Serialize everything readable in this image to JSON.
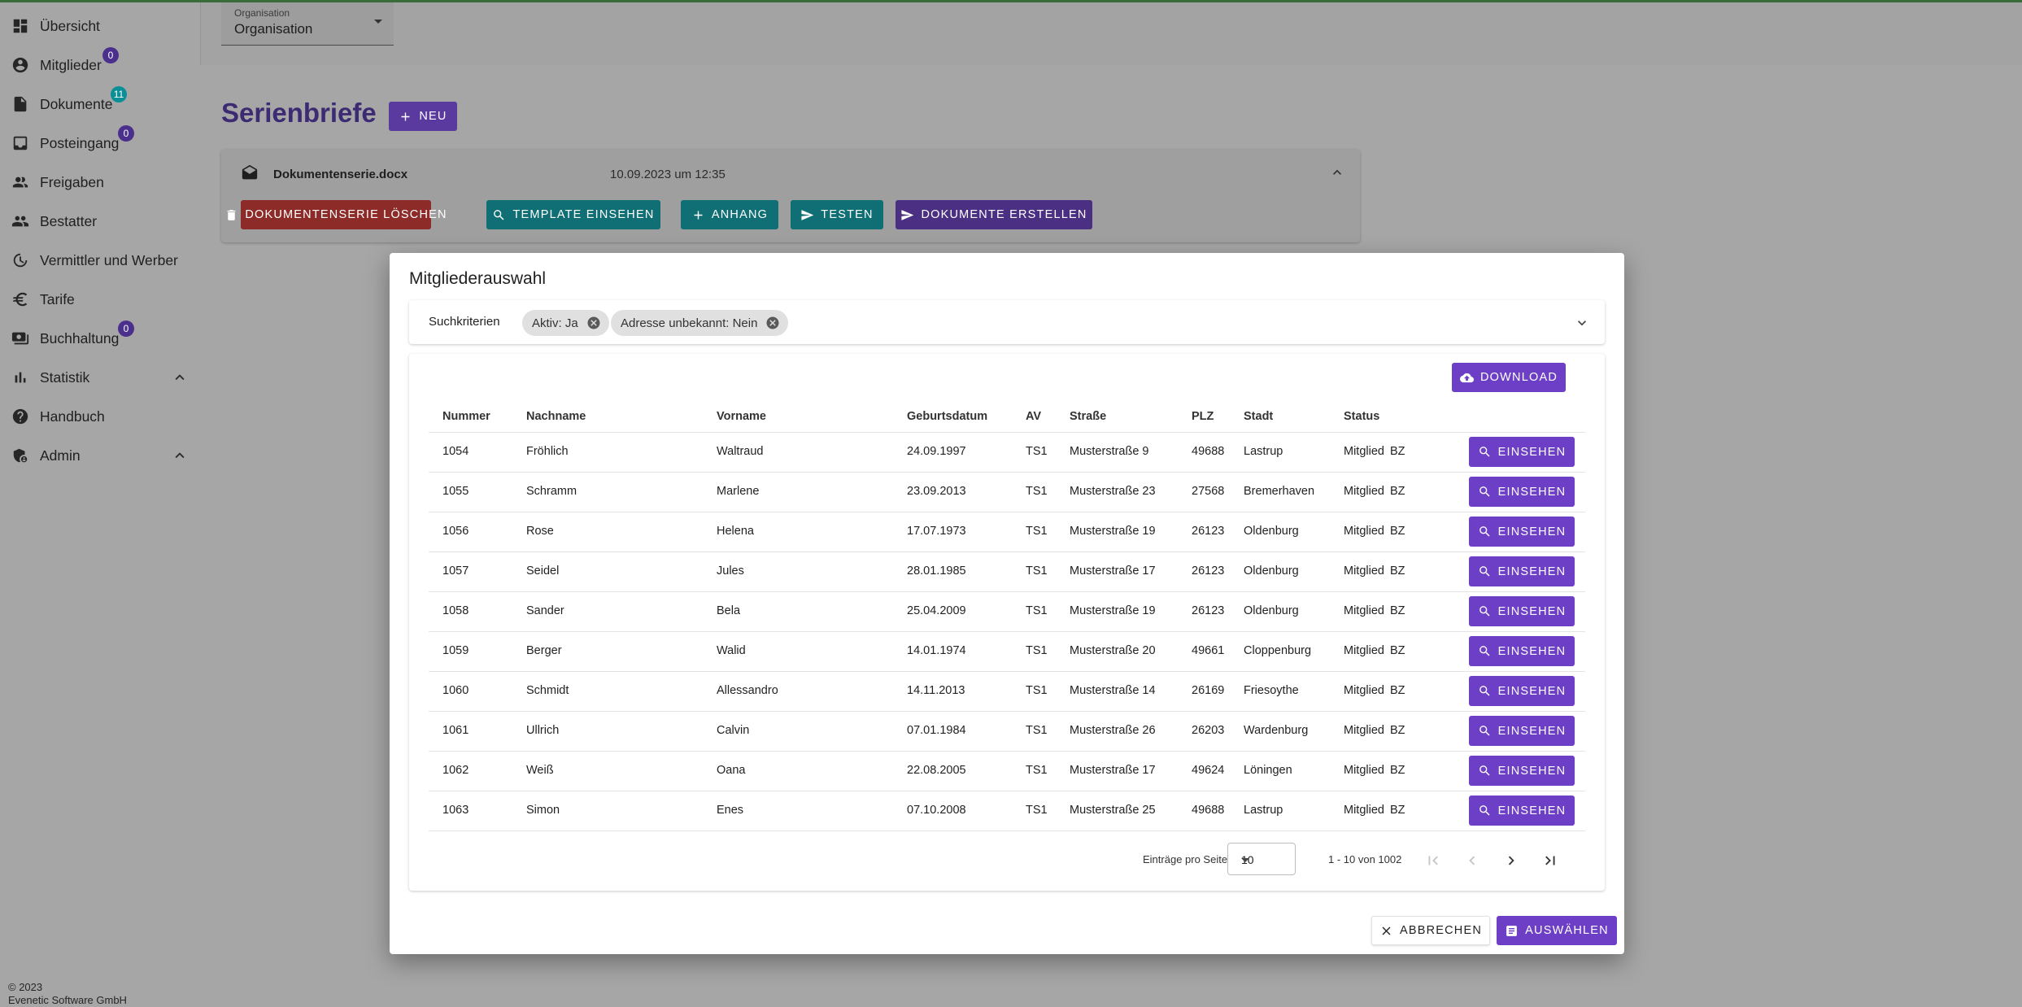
{
  "sidebar": {
    "items": [
      {
        "label": "Übersicht",
        "badge": "",
        "icon": "dashboard-icon"
      },
      {
        "label": "Mitglieder",
        "badge": "0",
        "icon": "account-circle-icon"
      },
      {
        "label": "Dokumente",
        "badge": "11",
        "icon": "document-icon"
      },
      {
        "label": "Posteingang",
        "badge": "0",
        "icon": "inbox-icon"
      },
      {
        "label": "Freigaben",
        "badge": "",
        "icon": "people-icon"
      },
      {
        "label": "Bestatter",
        "badge": "",
        "icon": "group-icon"
      },
      {
        "label": "Vermittler und Werber",
        "badge": "",
        "icon": "handshake-icon"
      },
      {
        "label": "Tarife",
        "badge": "",
        "icon": "euro-icon"
      },
      {
        "label": "Buchhaltung",
        "badge": "0",
        "icon": "payments-icon"
      },
      {
        "label": "Statistik",
        "badge": "",
        "icon": "bar-chart-icon"
      },
      {
        "label": "Handbuch",
        "badge": "",
        "icon": "help-icon"
      },
      {
        "label": "Admin",
        "badge": "",
        "icon": "admin-icon"
      }
    ],
    "badge_colors": {
      "purple": "#4a2f8c",
      "teal": "#0a8f97"
    },
    "footer_year": "© 2023",
    "footer_company": "Evenetic Software GmbH"
  },
  "org": {
    "label": "Organisation",
    "value": "Organisation"
  },
  "page": {
    "title": "Serienbriefe",
    "new_label": "Neu",
    "series": {
      "filename": "Dokumentenserie.docx",
      "date": "10.09.2023 um 12:35",
      "actions": {
        "delete": "Dokumentenserie löschen",
        "template": "Template einsehen",
        "attachment": "Anhang",
        "test": "Testen",
        "create": "Dokumente erstellen"
      }
    }
  },
  "colors": {
    "primary": "#6d3fc6",
    "danger": "#c93a35",
    "accent": "#0aa1a9"
  },
  "dialog": {
    "title": "Mitgliederauswahl",
    "criteria_label": "Suchkriterien",
    "chips": [
      "Aktiv: Ja",
      "Adresse unbekannt: Nein"
    ],
    "download_label": "Download",
    "columns": [
      "Nummer",
      "Nachname",
      "Vorname",
      "Geburtsdatum",
      "AV",
      "Straße",
      "PLZ",
      "Stadt",
      "Status"
    ],
    "view_label": "Einsehen",
    "rows": [
      [
        "1054",
        "Fröhlich",
        "Waltraud",
        "24.09.1997",
        "TS1",
        "Musterstraße 9",
        "49688",
        "Lastrup",
        "Mitglied",
        "BZ"
      ],
      [
        "1055",
        "Schramm",
        "Marlene",
        "23.09.2013",
        "TS1",
        "Musterstraße 23",
        "27568",
        "Bremerhaven",
        "Mitglied",
        "BZ"
      ],
      [
        "1056",
        "Rose",
        "Helena",
        "17.07.1973",
        "TS1",
        "Musterstraße 19",
        "26123",
        "Oldenburg",
        "Mitglied",
        "BZ"
      ],
      [
        "1057",
        "Seidel",
        "Jules",
        "28.01.1985",
        "TS1",
        "Musterstraße 17",
        "26123",
        "Oldenburg",
        "Mitglied",
        "BZ"
      ],
      [
        "1058",
        "Sander",
        "Bela",
        "25.04.2009",
        "TS1",
        "Musterstraße 19",
        "26123",
        "Oldenburg",
        "Mitglied",
        "BZ"
      ],
      [
        "1059",
        "Berger",
        "Walid",
        "14.01.1974",
        "TS1",
        "Musterstraße 20",
        "49661",
        "Cloppenburg",
        "Mitglied",
        "BZ"
      ],
      [
        "1060",
        "Schmidt",
        "Allessandro",
        "14.11.2013",
        "TS1",
        "Musterstraße 14",
        "26169",
        "Friesoythe",
        "Mitglied",
        "BZ"
      ],
      [
        "1061",
        "Ullrich",
        "Calvin",
        "07.01.1984",
        "TS1",
        "Musterstraße 26",
        "26203",
        "Wardenburg",
        "Mitglied",
        "BZ"
      ],
      [
        "1062",
        "Weiß",
        "Oana",
        "22.08.2005",
        "TS1",
        "Musterstraße 17",
        "49624",
        "Löningen",
        "Mitglied",
        "BZ"
      ],
      [
        "1063",
        "Simon",
        "Enes",
        "07.10.2008",
        "TS1",
        "Musterstraße 25",
        "49688",
        "Lastrup",
        "Mitglied",
        "BZ"
      ]
    ],
    "pagination": {
      "per_page_label": "Einträge pro Seite",
      "per_page": "10",
      "range": "1 - 10 von 1002"
    },
    "cancel_label": "Abbrechen",
    "select_label": "Auswählen"
  }
}
